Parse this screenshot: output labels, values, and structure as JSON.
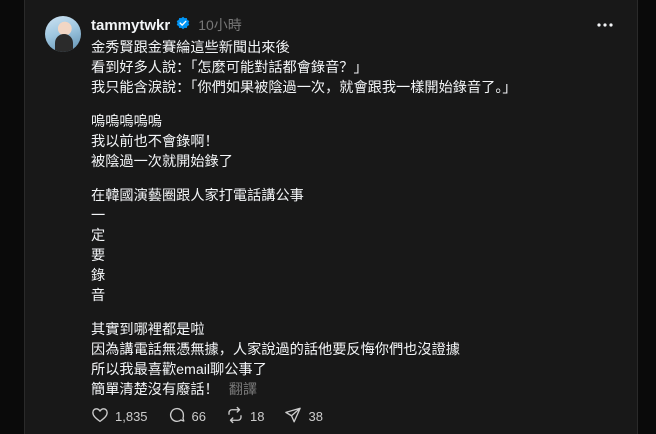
{
  "post": {
    "username": "tammytwkr",
    "time": "10小時",
    "paragraphs": [
      [
        "金秀賢跟金賽綸這些新聞出來後",
        "看到好多人說：「怎麼可能對話都會錄音？」",
        "我只能含淚說：「你們如果被陰過一次，就會跟我一樣開始錄音了。」"
      ],
      [
        "嗚嗚嗚嗚嗚",
        "我以前也不會錄啊！",
        "被陰過一次就開始錄了"
      ],
      [
        "在韓國演藝圈跟人家打電話講公事",
        "一",
        "定",
        "要",
        "錄",
        "音"
      ],
      [
        "其實到哪裡都是啦",
        "因為講電話無憑無據，人家說過的話他要反悔你們也沒證據",
        "所以我最喜歡email聊公事了",
        "簡單清楚沒有廢話！"
      ]
    ],
    "translate_label": "翻譯"
  },
  "actions": {
    "likes": "1,835",
    "comments": "66",
    "reposts": "18",
    "shares": "38"
  },
  "icons": [
    "verified-badge-icon",
    "more-icon",
    "heart-icon",
    "comment-icon",
    "repost-icon",
    "share-icon"
  ],
  "colors": {
    "background": "#181818",
    "text": "#f3f5f7",
    "muted": "#777777",
    "verified": "#0095f6"
  }
}
